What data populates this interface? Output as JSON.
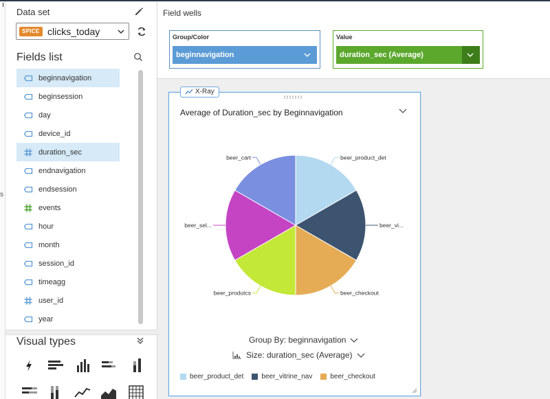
{
  "left_panel": {
    "dataset_label": "Data set",
    "spice_badge": "SPICE",
    "dataset_name": "clicks_today",
    "fields_title": "Fields list",
    "fields": [
      {
        "name": "beginnavigation",
        "type": "dimension",
        "selected": true
      },
      {
        "name": "beginsession",
        "type": "dimension",
        "selected": false
      },
      {
        "name": "day",
        "type": "dimension",
        "selected": false
      },
      {
        "name": "device_id",
        "type": "dimension",
        "selected": false
      },
      {
        "name": "duration_sec",
        "type": "measure",
        "selected": true
      },
      {
        "name": "endnavigation",
        "type": "dimension",
        "selected": false
      },
      {
        "name": "endsession",
        "type": "dimension",
        "selected": false
      },
      {
        "name": "events",
        "type": "measure-green",
        "selected": false
      },
      {
        "name": "hour",
        "type": "dimension",
        "selected": false
      },
      {
        "name": "month",
        "type": "dimension",
        "selected": false
      },
      {
        "name": "session_id",
        "type": "dimension",
        "selected": false
      },
      {
        "name": "timeagg",
        "type": "dimension",
        "selected": false
      },
      {
        "name": "user_id",
        "type": "measure",
        "selected": false
      },
      {
        "name": "year",
        "type": "dimension",
        "selected": false
      }
    ],
    "visual_types_title": "Visual types"
  },
  "field_wells": {
    "title": "Field wells",
    "group_color_label": "Group/Color",
    "group_color_value": "beginnavigation",
    "value_label": "Value",
    "value_value": "duration_sec (Average)"
  },
  "visual": {
    "xray_label": "X-Ray",
    "title": "Average of Duration_sec by Beginnavigation",
    "group_by": "Group By: beginnavigation",
    "size_by": "Size: duration_sec (Average)"
  },
  "colors": {
    "accent_blue": "#5b9bd6",
    "accent_green": "#5ba82d",
    "spice_orange": "#e38a2e"
  },
  "chart_data": {
    "type": "pie",
    "title": "Average of Duration_sec by Beginnavigation",
    "slices": [
      {
        "label": "beer_product_det",
        "value": 1,
        "color": "#b3d9f0"
      },
      {
        "label": "beer_vitrine_nav",
        "value": 1,
        "color": "#3d5470"
      },
      {
        "label": "beer_checkout",
        "value": 1,
        "color": "#e5ac55"
      },
      {
        "label": "beer_produtcs",
        "value": 1,
        "color": "#c4e838"
      },
      {
        "label": "beer_sel...",
        "value": 1,
        "color": "#c444c4"
      },
      {
        "label": "beer_cart",
        "value": 1,
        "color": "#7b8fe0"
      }
    ],
    "slice_labels_shown": [
      "beer_product_det",
      "beer_vi...",
      "beer_checkout",
      "beer_produtcs",
      "beer_sel...",
      "beer_cart"
    ],
    "legend": [
      "beer_product_det",
      "beer_vitrine_nav",
      "beer_checkout"
    ],
    "legend_position": "bottom"
  }
}
